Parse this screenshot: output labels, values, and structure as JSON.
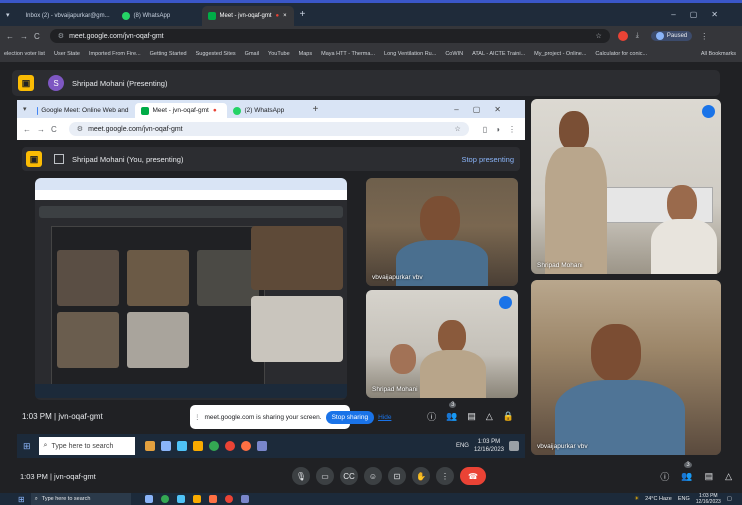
{
  "outer_browser": {
    "tabs": [
      {
        "label": "Inbox (2) - vbvaijapurkar@gm...",
        "active": false
      },
      {
        "label": "(8) WhatsApp",
        "active": false
      },
      {
        "label": "Meet - jvn-oqaf-gmt",
        "active": true
      }
    ],
    "url": "meet.google.com/jvn-oqaf-gmt",
    "profile_label": "Paused",
    "bookmarks": [
      "election voter list",
      "User State",
      "Imported From Fire...",
      "Getting Started",
      "Suggested Sites",
      "Gmail",
      "YouTube",
      "Maps",
      "Maya HTT - Therma...",
      "Long Ventilation Ru...",
      "CoWIN",
      "ATAL - AICTE Traini...",
      "My_project - Online...",
      "Calculator for conic..."
    ],
    "bookmarks_more": "All Bookmarks"
  },
  "meet_top": {
    "avatar_letter": "S",
    "presenter": "Shripad Mohani (Presenting)"
  },
  "inner_browser": {
    "tabs": [
      {
        "label": "Google Meet: Online Web and",
        "active": false
      },
      {
        "label": "Meet - jvn-oqaf-gmt",
        "active": true
      },
      {
        "label": "(2) WhatsApp",
        "active": false
      }
    ],
    "url": "meet.google.com/jvn-oqaf-gmt",
    "present_label": "Shripad Mohani (You, presenting)",
    "stop_presenting": "Stop presenting",
    "time_code": "1:03 PM  |  jvn-oqaf-gmt",
    "share_notice": "meet.google.com is sharing your screen.",
    "stop_sharing": "Stop sharing",
    "hide": "Hide",
    "tile_names": [
      "vbvaijapurkar vbv",
      "Shripad Mohani"
    ],
    "participant_count": "3",
    "taskbar": {
      "search": "Type here to search",
      "time": "1:03 PM",
      "date": "12/16/2023",
      "lang": "ENG"
    }
  },
  "right_tiles": [
    {
      "name": "Shripad Mohani"
    },
    {
      "name": "vbvaijapurkar vbv"
    }
  ],
  "bottom_bar": {
    "time_code": "1:03 PM  |  jvn-oqaf-gmt",
    "participant_count": "3"
  },
  "taskbar": {
    "search": "Type here to search",
    "weather": "24°C  Haze",
    "lang": "ENG",
    "time": "1:03 PM",
    "date": "12/16/2023"
  },
  "colors": {
    "accent": "#1a73e8",
    "hangup": "#ea4335",
    "present_yellow": "#fbbc04",
    "avatar_purple": "#7e57c2"
  }
}
